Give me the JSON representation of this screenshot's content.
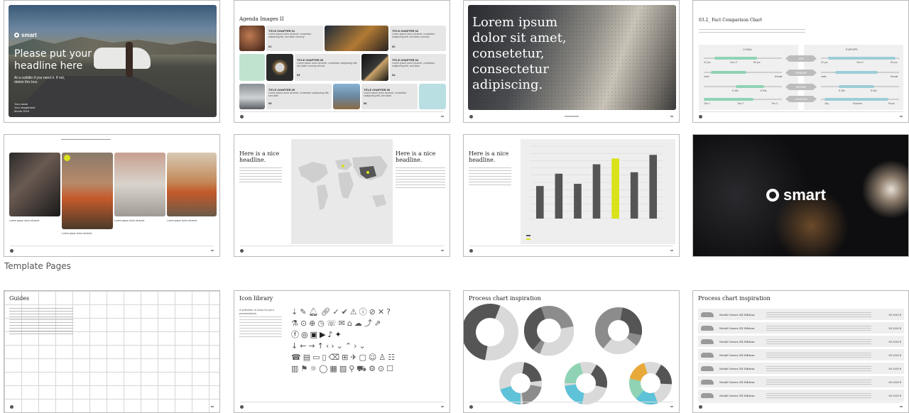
{
  "section_label": "Template Pages",
  "thumbs": {
    "t1": {
      "brand": "smart",
      "headline": "Please put your headline here",
      "subtitle": "At a subtitle if you need it. If not, delete this box.",
      "meta": [
        "Your name",
        "Your department",
        "Month 2024"
      ]
    },
    "t2": {
      "title": "Agenda Images II",
      "items": [
        {
          "title": "TITLE CHAPTER 01",
          "text": "Lorem ipsum dolor sit amet, consetetur adipiscing elit, sed diam nonumy",
          "num": "01"
        },
        {
          "title": "TITLE CHAPTER 02",
          "text": "Lorem ipsum dolor sit amet, consetetur sadipscing elitr, sed diam nonumy",
          "num": "02"
        },
        {
          "title": "TITLE CHAPTER 03",
          "text": "Lorem ipsum dolor sit amet, consetetur sadipscing elitr, sed diam nonumy eirmod",
          "num": "03"
        },
        {
          "title": "TITLE CHAPTER 04",
          "text": "Lorem ipsum dolor sit amet, consetetur sadipscing elitr, sed diam",
          "num": "04"
        },
        {
          "title": "TITLE CHAPTER 05",
          "text": "Lorem ipsum dolor sit amet, consetetur sadipscing elitr, sed diam",
          "num": "05"
        },
        {
          "title": "TITLE CHAPTER 06",
          "text": "Lorem ipsum dolor sit amet, consetetur sadipscing elitr, sed diam",
          "num": "06"
        }
      ]
    },
    "t3": {
      "quote": "Lorem ipsum dolor sit amet, consetetur, consectetur adipiscing."
    },
    "t4": {
      "title": "03.2_ Fact Comparison Chart",
      "left_label": "CHINA",
      "right_label": "EUROPE",
      "labels": [
        "22 yrs",
        "Gen Z",
        "50 yrs",
        "male",
        "female",
        "€ 40k",
        "€ 90k",
        "Tier 1",
        "Tier 2",
        "Tier 3",
        "22 yrs",
        "Gen Z",
        "50 yrs",
        "male",
        "female",
        "€ 30k",
        "€ 60k",
        "City",
        "Suburbs",
        "Rural"
      ],
      "pills": [
        "AGE",
        "GENDER",
        "INCOME",
        "LOCATION"
      ]
    },
    "t5": {
      "captions": [
        "Lorem ipsum dolor sit amet.",
        "Lorem ipsum dolor sit amet.",
        "Lorem ipsum dolor sit amet.",
        "Lorem ipsum dolor sit amet."
      ]
    },
    "t6": {
      "headline": "Here is a nice headline.",
      "headline2": "Here is a nice headline."
    },
    "t7": {
      "headline": "Here is a nice headline."
    },
    "t8": {
      "brand": "smart"
    },
    "t9": {
      "title": "Guides"
    },
    "t10": {
      "title": "Icon library",
      "intro": "A selection of icons for your presentations."
    },
    "t11": {
      "title": "Process chart inspiration"
    },
    "t12": {
      "title": "Process chart inspiration",
      "rows": [
        {
          "name": "Model Series XX Edition",
          "price": "XX.XXX €"
        },
        {
          "name": "Model Series XX Edition",
          "price": "XX.XXX €"
        },
        {
          "name": "Model Series XX Edition",
          "price": "XX.XXX €"
        },
        {
          "name": "Model Series XX Edition",
          "price": "XX.XXX €"
        },
        {
          "name": "Model Series XX Edition",
          "price": "XX.XXX €"
        },
        {
          "name": "Model Series XX Edition",
          "price": "XX.XXX €"
        },
        {
          "name": "Model Series XX Edition",
          "price": "XX.XXX €"
        }
      ]
    }
  },
  "chart_data": {
    "type": "bar",
    "categories": [
      "",
      "",
      "",
      "",
      "",
      "",
      ""
    ],
    "values": [
      45,
      62,
      48,
      75,
      83,
      64,
      88
    ],
    "ylim": [
      0,
      100
    ],
    "highlight_index": 4,
    "colors": {
      "default": "#555555",
      "highlight": "#d9e21a"
    }
  },
  "colors": {
    "accent_lime": "#d9e21a",
    "mint": "#8fd3b4",
    "teal": "#5ec2d8",
    "sand": "#e8a93a",
    "pill_grey": "#bdbdbd"
  }
}
